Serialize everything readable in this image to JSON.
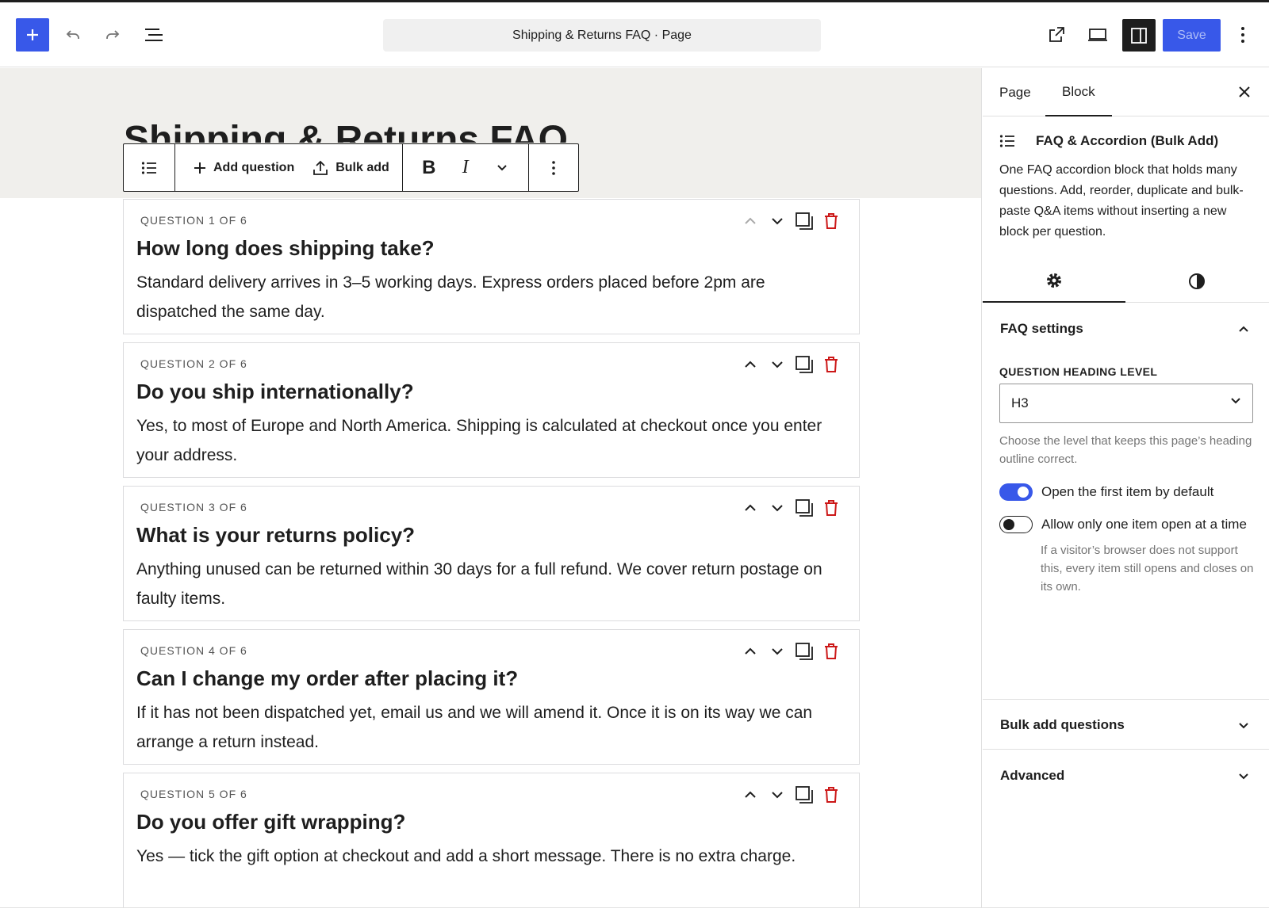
{
  "header": {
    "doc_title": "Shipping & Returns FAQ · Page",
    "save_label": "Save",
    "icons": [
      "plus-icon",
      "undo-icon",
      "redo-icon",
      "list-view-icon",
      "external-link-icon",
      "desktop-preview-icon",
      "sidebar-icon",
      "more-vertical-icon"
    ]
  },
  "canvas": {
    "page_title": "Shipping & Returns FAQ"
  },
  "block_toolbar": {
    "add_question": "Add question",
    "bulk_add": "Bulk add",
    "bold": "B",
    "italic": "I"
  },
  "faq_items": [
    {
      "label": "QUESTION 1 OF 6",
      "question": "How long does shipping take?",
      "answer": "Standard delivery arrives in 3–5 working days. Express orders placed before 2pm are dispatched the same day."
    },
    {
      "label": "QUESTION 2 OF 6",
      "question": "Do you ship internationally?",
      "answer": "Yes, to most of Europe and North America. Shipping is calculated at checkout once you enter your address."
    },
    {
      "label": "QUESTION 3 OF 6",
      "question": "What is your returns policy?",
      "answer": "Anything unused can be returned within 30 days for a full refund. We cover return postage on faulty items."
    },
    {
      "label": "QUESTION 4 OF 6",
      "question": "Can I change my order after placing it?",
      "answer": "If it has not been dispatched yet, email us and we will amend it. Once it is on its way we can arrange a return instead."
    },
    {
      "label": "QUESTION 5 OF 6",
      "question": "Do you offer gift wrapping?",
      "answer": "Yes — tick the gift option at checkout and add a short message. There is no extra charge."
    }
  ],
  "sidebar": {
    "tabs": [
      "Page",
      "Block"
    ],
    "block_name": "FAQ & Accordion (Bulk Add)",
    "block_desc": "One FAQ accordion block that holds many questions. Add, reorder, duplicate and bulk-paste Q&A items without inserting a new block per question.",
    "faq_settings": {
      "title": "FAQ settings",
      "heading_label": "QUESTION HEADING LEVEL",
      "heading_value": "H3",
      "heading_help": "Choose the level that keeps this page’s heading outline correct.",
      "toggle1": "Open the first item by default",
      "toggle1_on": true,
      "toggle2": "Allow only one item open at a time",
      "toggle2_on": false,
      "toggle2_help": "If a visitor’s browser does not support this, every item still opens and closes on its own."
    },
    "bulk_add_title": "Bulk add questions",
    "advanced_title": "Advanced"
  },
  "colors": {
    "accent": "#3858e9",
    "delete": "#cc1818",
    "text": "#1e1e1e"
  }
}
